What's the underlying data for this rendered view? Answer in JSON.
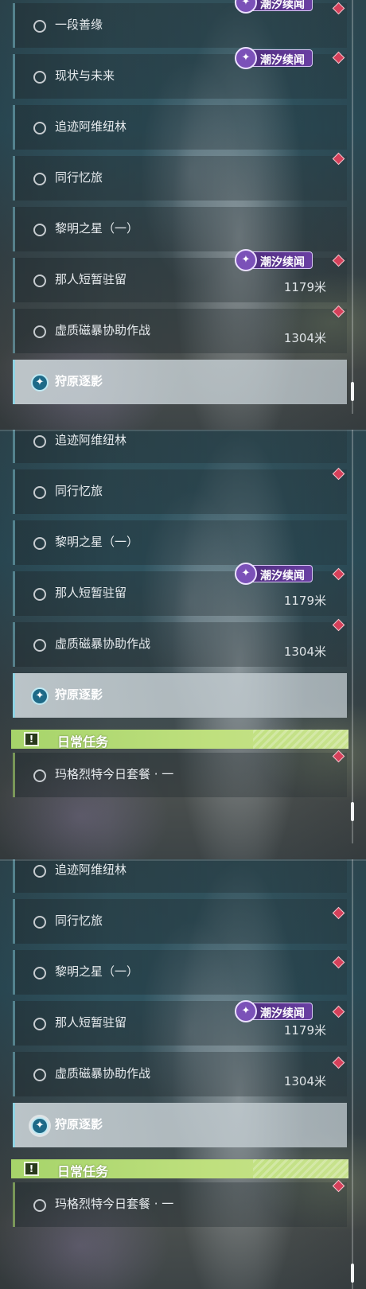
{
  "quests": {
    "one_duan": "一段善缘",
    "status_future": "现状与未来",
    "trace_avi": "追迹阿维纽林",
    "travel_memory": "同行忆旅",
    "dawn_star": "黎明之星（一）",
    "that_person": "那人短暂驻留",
    "void_storm": "虚质磁暴协助作战",
    "hunt_shadow": "狩原逐影"
  },
  "distances": {
    "that_person": "1179米",
    "void_storm": "1304米"
  },
  "badge": {
    "label": "潮汐续闻",
    "icon": "tide-event-icon"
  },
  "daily": {
    "header": "日常任务",
    "icon": "exclamation-icon",
    "quest_margaret": "玛格烈特今日套餐 · 一"
  },
  "colors": {
    "badge_bg": "#6a3fa3",
    "daily_accent": "#a6d46a",
    "marker": "#d6405a",
    "track_accent": "#1e6a88"
  }
}
